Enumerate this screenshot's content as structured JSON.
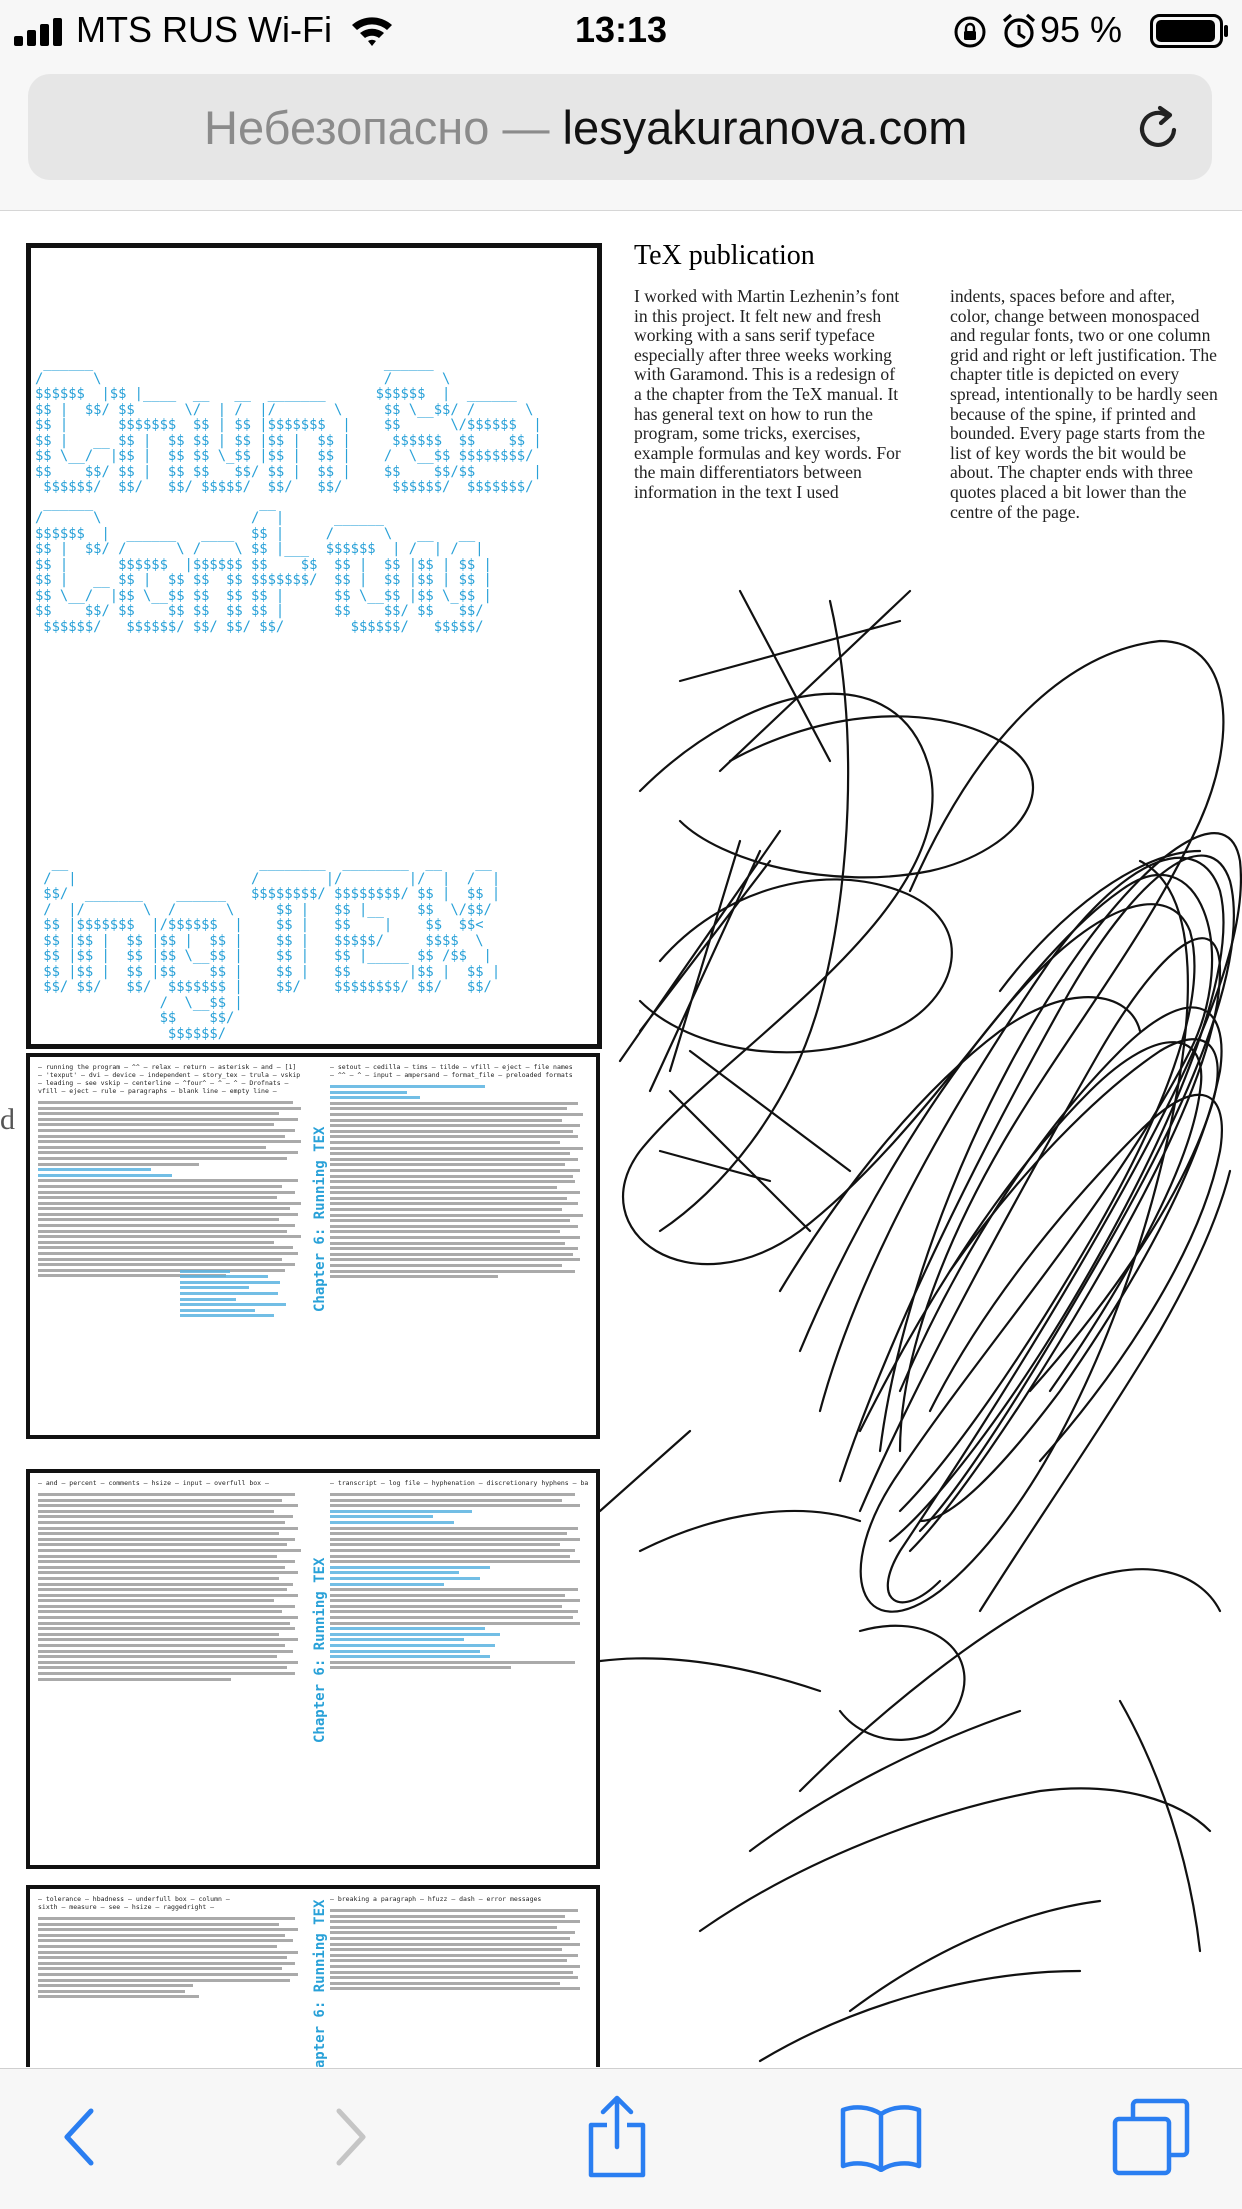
{
  "status_bar": {
    "carrier": "MTS RUS Wi-Fi",
    "time": "13:13",
    "battery": "95 %"
  },
  "address_bar": {
    "security_label": "Небезопасно",
    "separator": " — ",
    "domain": "lesyakuranova.com"
  },
  "article": {
    "title": "TeX publication",
    "col1": "I worked with Martin Lezhenin’s font in this project. It felt new and fresh working with a sans serif typeface especially after three weeks working with Garamond. This is a redesign of a the chapter from the TeX manual. It has general text on how to run the program, some tricks, exercises, example formulas and key words. For the main differentiators between information in the text I used",
    "col2": "indents, spaces before and after, color, change between monospaced and regular fonts, two or one column grid and right or left justification. The chapter title is depicted on every spread, intentionally to be hardly seen because of the spine, if printed and bounded. Every page starts from the list of key words the bit would be about. The chapter ends with three quotes placed a bit lower than the centre of the page."
  },
  "spreads": {
    "chapter_label": "Chapter 6: Running TEX",
    "spread2_keywords_left": "— running the program — ^^ — relax — return — asterisk — and — [1]\n— 'texput' — dvi — device — independent — story_tex — trula — vskip\n— leading — see vskip — centerline — ^four^ — ^ — ^ — Drofnats —\nvfill — eject — rule — paragraphs — blank line — empty line —",
    "spread2_keywords_right": "— setout — cedilla — tims — tilde — vfill — eject — file names\n— ^^ — ^ — input — ampersand — format_file — preloaded formats",
    "spread3_keywords_left": "— and — percent — comments — hsize — input — overfull box —",
    "spread3_keywords_right": "— transcript — log file — hyphenation — discretionary hyphens — badness —",
    "spread4_keywords_left": "— tolerance — hbadness — underfull box — column —\nsixth — measure — see — hsize — raggedright —",
    "spread4_keywords_right": "— breaking a paragraph — hfuzz — dash — error messages"
  },
  "toolbar": {
    "back": "back-icon",
    "forward": "forward-icon",
    "share": "share-icon",
    "bookmarks": "bookmarks-icon",
    "tabs": "tabs-icon"
  },
  "colors": {
    "accent_blue": "#29a1d8",
    "ios_blue": "#2a7ef1",
    "chrome_bg": "#f7f7f7"
  }
}
